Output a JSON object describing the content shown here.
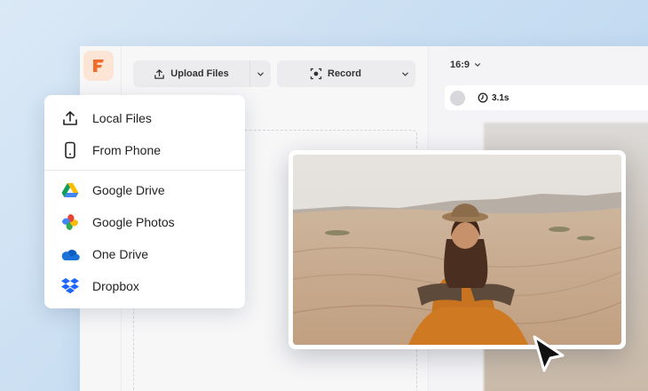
{
  "toolbar": {
    "upload_label": "Upload Files",
    "record_label": "Record"
  },
  "preview": {
    "aspect_ratio": "16:9",
    "duration": "3.1s"
  },
  "upload_menu": {
    "items": [
      {
        "label": "Local Files",
        "icon": "upload-icon"
      },
      {
        "label": "From Phone",
        "icon": "phone-icon"
      },
      {
        "label": "Google Drive",
        "icon": "google-drive-icon"
      },
      {
        "label": "Google Photos",
        "icon": "google-photos-icon"
      },
      {
        "label": "One Drive",
        "icon": "onedrive-icon"
      },
      {
        "label": "Dropbox",
        "icon": "dropbox-icon"
      }
    ]
  },
  "colors": {
    "brand": "#f26b2a",
    "onedrive": "#1a73d9",
    "dropbox": "#1f66ff"
  }
}
